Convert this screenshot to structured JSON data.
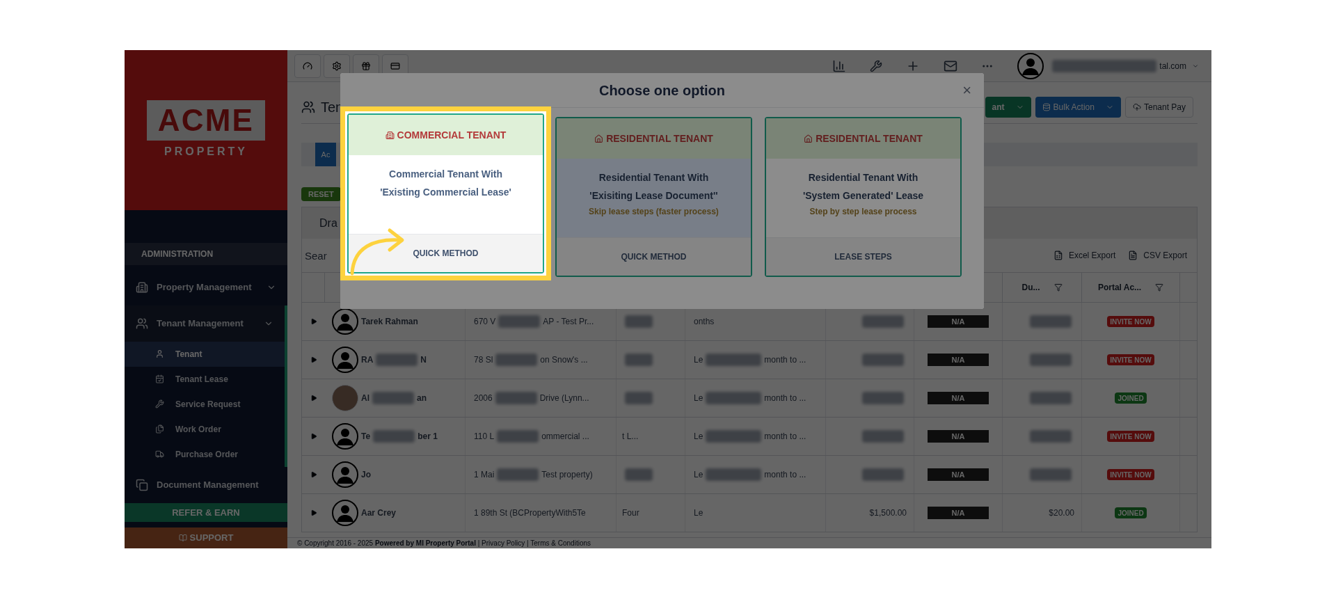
{
  "sidebar": {
    "logo": {
      "wordmark": "ACME",
      "tagline": "PROPERTY"
    },
    "section": "ADMINISTRATION",
    "items": [
      {
        "label": "Property Management",
        "selected": false
      },
      {
        "label": "Tenant Management",
        "selected": true,
        "children": [
          {
            "label": "Tenant",
            "selected": true
          },
          {
            "label": "Tenant Lease",
            "selected": false
          },
          {
            "label": "Service Request",
            "selected": false
          },
          {
            "label": "Work Order",
            "selected": false
          },
          {
            "label": "Purchase Order",
            "selected": false
          }
        ]
      },
      {
        "label": "Document Management",
        "selected": false
      }
    ],
    "refer": "REFER & EARN",
    "support": "SUPPORT"
  },
  "topbar": {
    "user_email": "tal.com"
  },
  "page": {
    "title": "Ten",
    "actions": [
      {
        "label": "ant",
        "kind": "primary"
      },
      {
        "label": "Bulk Action",
        "kind": "info"
      },
      {
        "label": "Tenant Pay",
        "kind": "default"
      }
    ],
    "tab": "Ac",
    "reset": "RESET",
    "panel_tab": "Dra",
    "search": {
      "placeholder": "Sear"
    },
    "exports": [
      "Excel Export",
      "CSV Export"
    ]
  },
  "table": {
    "columns": [
      {
        "label": "Du..."
      },
      {
        "label": "Portal Ac..."
      }
    ],
    "rows": [
      {
        "photo": false,
        "name": [
          "Tarek Rahman"
        ],
        "address": [
          "670 V",
          "AP - Test Pr..."
        ],
        "unit": [],
        "lease": [
          "onths"
        ],
        "rent": [],
        "status": "N/A",
        "due": [],
        "portal": {
          "label": "INVITE NOW",
          "kind": "invite"
        }
      },
      {
        "photo": false,
        "name": [
          "RA",
          "N"
        ],
        "address": [
          "78 Sl",
          "on Snow's ..."
        ],
        "unit": [],
        "lease": [
          "Le",
          "month to ..."
        ],
        "rent": [],
        "status": "N/A",
        "due": [],
        "portal": {
          "label": "INVITE NOW",
          "kind": "invite"
        }
      },
      {
        "photo": true,
        "name": [
          "Al",
          "an"
        ],
        "address": [
          "2006",
          "Drive (Lynn..."
        ],
        "unit": [],
        "lease": [
          "Le",
          "month to ..."
        ],
        "rent": [],
        "status": "N/A",
        "due": [],
        "portal": {
          "label": "JOINED",
          "kind": "joined"
        }
      },
      {
        "photo": false,
        "name": [
          "Te",
          "ber 1"
        ],
        "address": [
          "110 L",
          "ommercial ..."
        ],
        "unit": [
          "t L..."
        ],
        "lease": [
          "Le",
          "month to ..."
        ],
        "rent": [],
        "status": "N/A",
        "due": [],
        "portal": {
          "label": "INVITE NOW",
          "kind": "invite"
        }
      },
      {
        "photo": false,
        "name": [
          "Jo"
        ],
        "address": [
          "1 Mai",
          "Test property)"
        ],
        "unit": [],
        "lease": [
          "Le",
          "month to ..."
        ],
        "rent": [],
        "status": "N/A",
        "due": [],
        "portal": {
          "label": "INVITE NOW",
          "kind": "invite"
        }
      },
      {
        "photo": false,
        "name": [
          "Aar Crey"
        ],
        "address": [
          "1 89th St (BCPropertyWith5Te"
        ],
        "unit": [
          "Four"
        ],
        "lease": [
          "Le"
        ],
        "rent": [
          "$1,500.00"
        ],
        "status": "N/A",
        "due": [
          "$20.00"
        ],
        "portal": {
          "label": "JOINED",
          "kind": "joined"
        }
      }
    ]
  },
  "footer": "© Copyright 2016 - 2025 **Powered by MI Property Portal** | Privacy Policy | Terms & Conditions",
  "modal": {
    "title": "Choose one option",
    "close": "×",
    "cards": [
      {
        "kind": "commercial",
        "title": "COMMERCIAL TENANT",
        "lines": [
          "Commercial Tenant With",
          "'Existing Commercial Lease'"
        ],
        "action": "QUICK METHOD",
        "highlighted": true,
        "hovered": false
      },
      {
        "kind": "residential",
        "title": "RESIDENTIAL TENANT",
        "lines": [
          "Residential Tenant With",
          "'Exisiting Lease Document''"
        ],
        "note": "Skip lease steps (faster process)",
        "action": "QUICK METHOD",
        "highlighted": false,
        "hovered": true
      },
      {
        "kind": "residential",
        "title": "RESIDENTIAL TENANT",
        "lines": [
          "Residential Tenant With",
          "'System Generated' Lease"
        ],
        "note": "Step by step lease process",
        "action": "LEASE STEPS",
        "highlighted": false,
        "hovered": false
      }
    ]
  }
}
